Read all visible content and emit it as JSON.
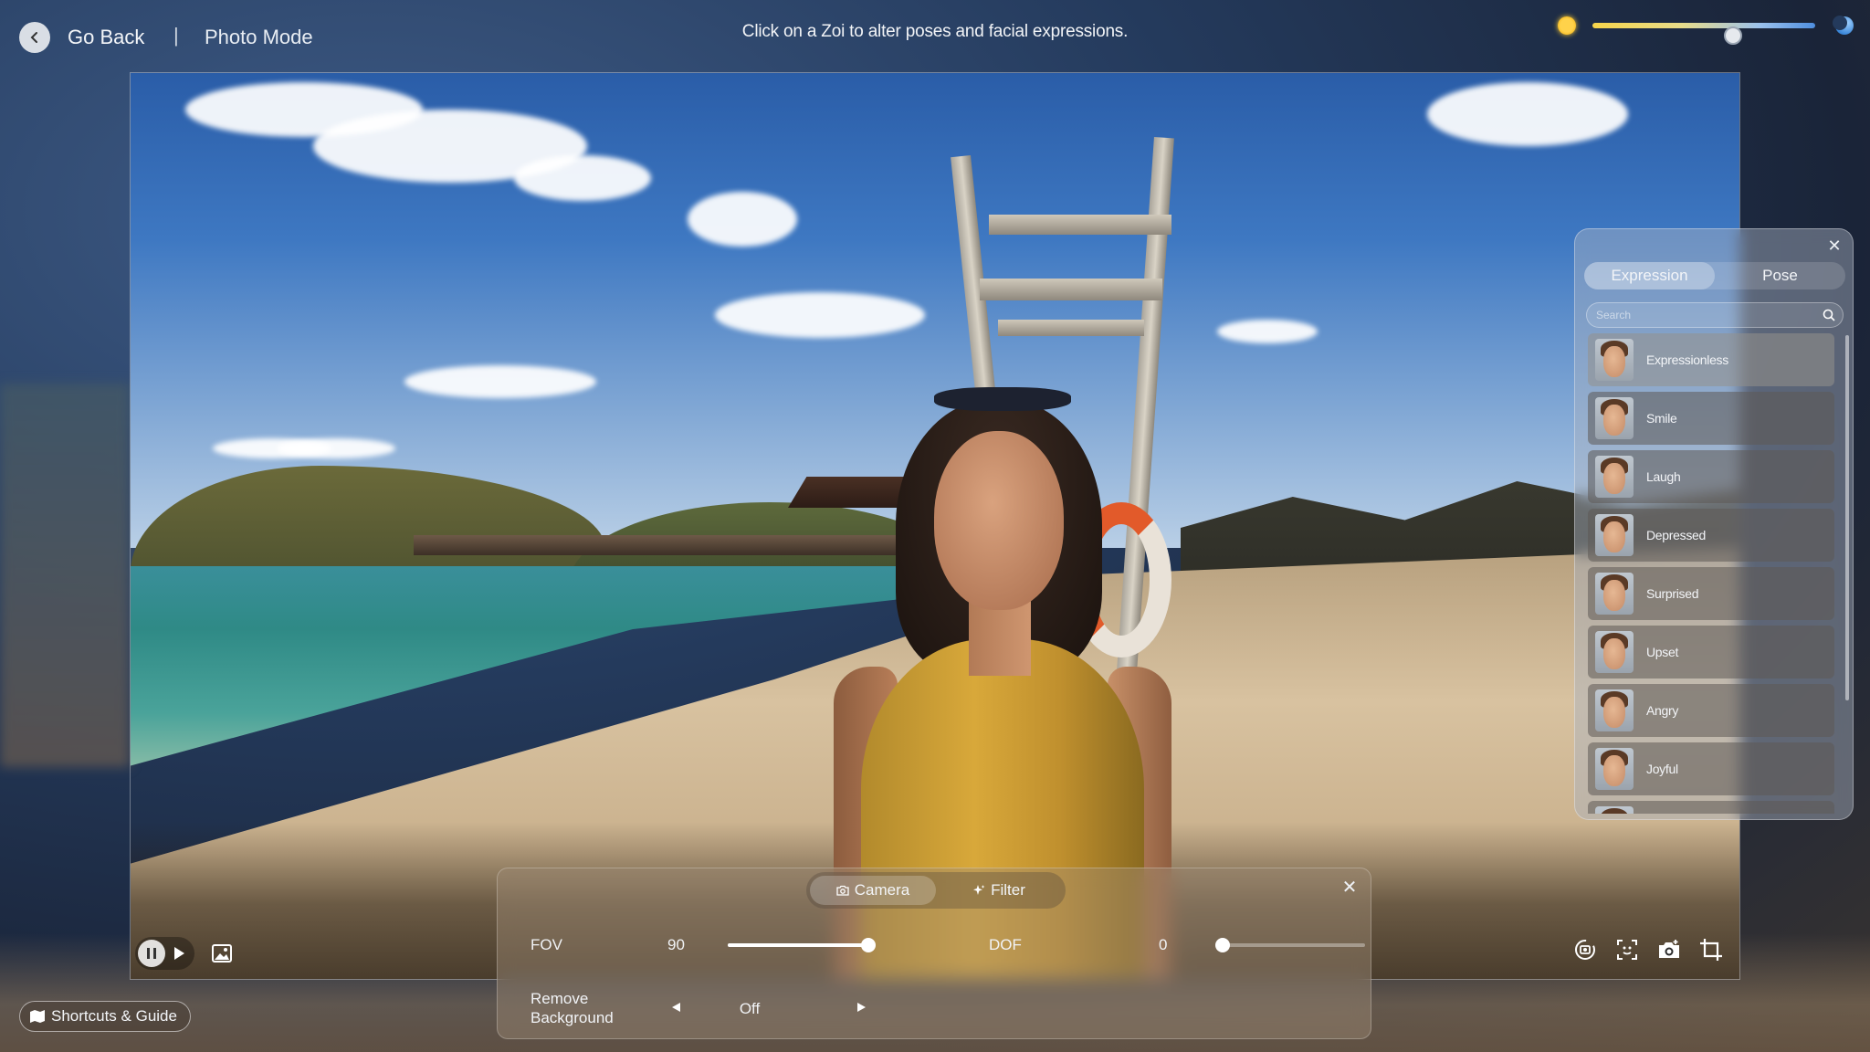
{
  "header": {
    "back_label": "Go Back",
    "separator": "|",
    "mode_title": "Photo Mode",
    "hint": "Click on a Zoi to alter poses and facial expressions.",
    "time_of_day": {
      "value_fraction": 0.63,
      "start_icon": "sun-icon",
      "end_icon": "moon-icon"
    }
  },
  "expression_panel": {
    "tabs": [
      {
        "label": "Expression",
        "active": true
      },
      {
        "label": "Pose",
        "active": false
      }
    ],
    "search_placeholder": "Search",
    "items": [
      {
        "label": "Expressionless"
      },
      {
        "label": "Smile"
      },
      {
        "label": "Laugh"
      },
      {
        "label": "Depressed"
      },
      {
        "label": "Surprised"
      },
      {
        "label": "Upset"
      },
      {
        "label": "Angry"
      },
      {
        "label": "Joyful"
      }
    ]
  },
  "camera_panel": {
    "tabs": [
      {
        "label": "Camera",
        "icon": "camera-icon",
        "active": true
      },
      {
        "label": "Filter",
        "icon": "sparkle-icon",
        "active": false
      }
    ],
    "fov": {
      "label": "FOV",
      "value": "90",
      "fraction": 1.0
    },
    "dof": {
      "label": "DOF",
      "value": "0",
      "fraction": 0.0
    },
    "remove_background": {
      "label": "Remove Background",
      "value": "Off"
    }
  },
  "footer": {
    "shortcuts_label": "Shortcuts & Guide"
  },
  "colors": {
    "accent_sun": "#ffd24a",
    "accent_moon": "#4f8fe0"
  }
}
